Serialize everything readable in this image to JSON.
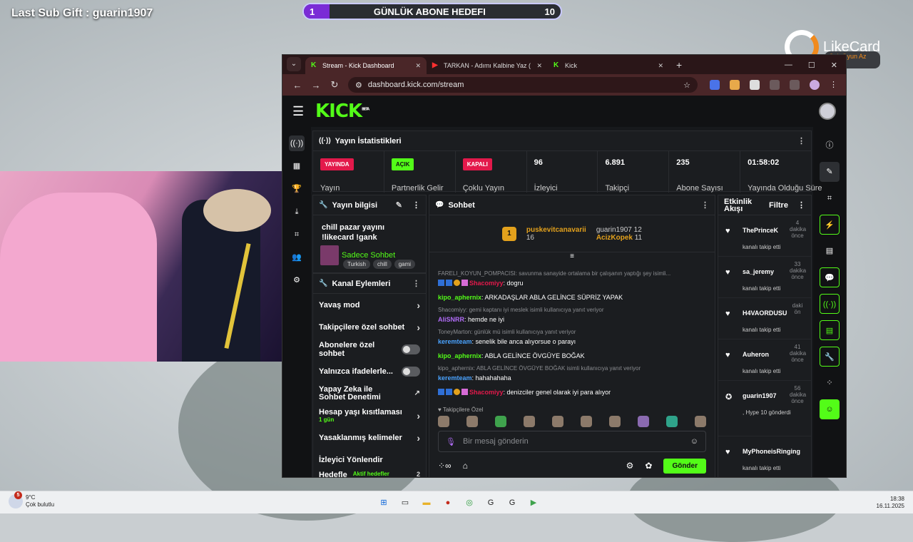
{
  "overlay": {
    "last_sub": "Last Sub Gift : guarin1907",
    "goal_current": "1",
    "goal_title": "GÜNLÜK ABONE HEDEFI",
    "goal_target": "10",
    "goal_progress": 0.1,
    "brand_name": "LikeCard",
    "brand_tag": "Çok Oyun Az Öde"
  },
  "browser": {
    "tabs": [
      {
        "label": "Stream - Kick Dashboard",
        "active": true
      },
      {
        "label": "TARKAN - Adımı Kalbine Yaz (",
        "active": false
      },
      {
        "label": "Kick",
        "active": false
      }
    ],
    "url": "dashboard.kick.com/stream"
  },
  "kick": {
    "logo": "KICK",
    "beta": "BETA"
  },
  "stats": {
    "title": "Yayın İstatistikleri",
    "cells": [
      {
        "badge": "YAYINDA",
        "badge_color": "#e3194b",
        "label": "Yayın"
      },
      {
        "badge": "AÇIK",
        "badge_color": "#53fc18",
        "label": "Partnerlik Gelir"
      },
      {
        "badge": "KAPALI",
        "badge_color": "#e3194b",
        "label": "Çoklu Yayın"
      },
      {
        "value": "96",
        "label": "İzleyici"
      },
      {
        "value": "6.891",
        "label": "Takipçi"
      },
      {
        "value": "235",
        "label": "Abone Sayısı"
      },
      {
        "value": "01:58:02",
        "label": "Yayında Olduğu Süre"
      }
    ]
  },
  "info": {
    "title": "Yayın bilgisi",
    "stream_title": "chill pazar yayını !likecard !gank",
    "category": "Sadece Sohbet",
    "tags": [
      "Turkish",
      "chill",
      "gami"
    ]
  },
  "actions": {
    "title": "Kanal Eylemleri",
    "items": [
      {
        "label": "Yavaş mod",
        "type": "chevron"
      },
      {
        "label": "Takipçilere özel sohbet",
        "type": "chevron"
      },
      {
        "label": "Abonelere özel sohbet",
        "type": "toggle"
      },
      {
        "label": "Yalnızca ifadelerle...",
        "type": "toggle"
      },
      {
        "label": "Yapay Zeka ile Sohbet Denetimi",
        "type": "link"
      },
      {
        "label": "Hesap yaşı kısıtlaması",
        "sub": "1 gün",
        "type": "chevron"
      },
      {
        "label": "Yasaklanmış kelimeler",
        "type": "chevron"
      },
      {
        "label": "İzleyici Yönlendir",
        "type": "none"
      },
      {
        "label": "Hedefle",
        "sub2": "Aktif hedefler",
        "count": "2",
        "type": "chevron"
      }
    ]
  },
  "chat": {
    "title": "Sohbet",
    "pinned": {
      "gift_rank": "1",
      "top_user": "puskevitcanavarii",
      "top_count": "16",
      "second_user": "guarin1907",
      "second_count": "12",
      "third_user": "AcizKopek",
      "third_count": "11"
    },
    "messages": [
      {
        "reply": "FARELI_KOYUN_POMPACISI: savunma sanayide ortalama bir çalışanın yaptığı şey isimli...",
        "user": "Shacomiyy",
        "user_class": "u2",
        "text": "dogru",
        "badges": true
      },
      {
        "reply": "",
        "user": "kipo_aphernix",
        "user_class": "u1",
        "text": "ARKADAŞLAR ABLA GELİNCE SÜPRİZ YAPAK"
      },
      {
        "reply": "Shacomiyy: gemi kaptanı iyi meslek isimli kullanıcıya yanıt veriyor",
        "user": "AliSNRR",
        "user_class": "u3",
        "text": "hemde ne iyi"
      },
      {
        "reply": "ToneyMarton: günlük mü isimli kullanıcıya yanıt veriyor",
        "user": "keremteam",
        "user_class": "u4",
        "text": "senelik bile anca alıyorsue o parayı"
      },
      {
        "reply": "",
        "user": "kipo_aphernix",
        "user_class": "u1",
        "text": "ABLA GELİNCE ÖVGÜYE BOĞAK"
      },
      {
        "reply": "kipo_aphernix: ABLA GELİNCE ÖVGÜYE BOĞAK isimli kullanıcıya yanıt veriyor",
        "user": "keremteam",
        "user_class": "u4",
        "text": "hahahahaha"
      },
      {
        "reply": "",
        "user": "Shacomiyy",
        "user_class": "u2",
        "text": "denizciler genel olarak iyi para alıyor",
        "badges": true
      }
    ],
    "emotes_label": "Takipçilere Özel",
    "input_placeholder": "Bir mesaj gönderin",
    "send_label": "Gönder"
  },
  "feed": {
    "title": "Etkinlik Akışı",
    "filter": "Filtre",
    "items": [
      {
        "icon": "heart",
        "user": "ThePrinceK",
        "time": "4 dakika önce",
        "sub": "kanalı takip etti"
      },
      {
        "icon": "heart",
        "user": "sa_jeremy",
        "time": "33 dakika önce",
        "sub": "kanalı takip etti"
      },
      {
        "icon": "heart",
        "user": "H4VAORDUSU",
        "time": "daki ön",
        "sub": "kanalı takip etti"
      },
      {
        "icon": "heart",
        "user": "Auheron",
        "time": "41 dakika önce",
        "sub": "kanalı takip etti"
      },
      {
        "icon": "kick",
        "user": "guarin1907",
        "time": "56 dakika önce",
        "sub": ", Hype 10 gönderdi"
      },
      {
        "icon": "heart",
        "user": "MyPhoneisRinging",
        "time": "",
        "sub": "kanalı takip etti"
      }
    ]
  },
  "taskbar": {
    "temp": "9°C",
    "weather": "Çok bulutlu",
    "alerts": "5",
    "time": "18:38",
    "date": "16.11.2025"
  }
}
